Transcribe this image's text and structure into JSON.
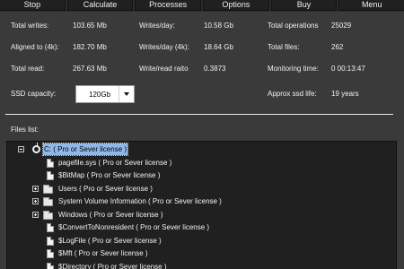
{
  "toolbar": {
    "stop": "Stop",
    "calculate": "Calculate",
    "processes": "Processes",
    "options": "Options",
    "buy": "Buy",
    "menu": "Menu"
  },
  "stats": {
    "total_writes_label": "Total writes:",
    "total_writes_value": "103.65 Mb",
    "aligned_label": "Aligned to (4k):",
    "aligned_value": "182.70 Mb",
    "total_read_label": "Total read:",
    "total_read_value": "267.63 Mb",
    "writes_day_label": "Writes/day:",
    "writes_day_value": "10.58 Gb",
    "writes_day_4k_label": "Writes/day (4k):",
    "writes_day_4k_value": "18.64 Gb",
    "write_read_ratio_label": "Write/read raito",
    "write_read_ratio_value": "0.3873",
    "total_operations_label": "Total operations",
    "total_operations_value": "25029",
    "total_files_label": "Total files:",
    "total_files_value": "262",
    "monitoring_time_label": "Monitoring time:",
    "monitoring_time_value": "0 00:13:47",
    "ssd_capacity_label": "SSD capacity:",
    "ssd_capacity_value": "120Gb",
    "approx_life_label": "Approx ssd life:",
    "approx_life_value": "19 years"
  },
  "files": {
    "list_label": "Files list:",
    "tree": [
      {
        "text": "C: ( Pro or Sever license )",
        "type": "drive",
        "expander": "minus",
        "selected": true,
        "name": "tree-node-drive-c"
      },
      {
        "text": "pagefile.sys ( Pro or Sever license )",
        "type": "file",
        "name": "tree-node-pagefile"
      },
      {
        "text": "$BitMap ( Pro or Sever license )",
        "type": "file",
        "name": "tree-node-bitmap"
      },
      {
        "text": "Users ( Pro or Sever license )",
        "type": "folder",
        "expander": "plus",
        "name": "tree-node-users"
      },
      {
        "text": "System Volume Information ( Pro or Sever license )",
        "type": "folder",
        "expander": "plus",
        "name": "tree-node-system-volume-information"
      },
      {
        "text": "Windows ( Pro or Sever license )",
        "type": "folder",
        "expander": "plus",
        "name": "tree-node-windows"
      },
      {
        "text": "$ConvertToNonresident ( Pro or Sever license )",
        "type": "file",
        "name": "tree-node-convert-to-nonresident"
      },
      {
        "text": "$LogFile ( Pro or Sever license )",
        "type": "file",
        "name": "tree-node-logfile"
      },
      {
        "text": "$Mft ( Pro or Sever license )",
        "type": "file",
        "name": "tree-node-mft"
      },
      {
        "text": "$Directory ( Pro or Sever license )",
        "type": "file",
        "name": "tree-node-directory"
      }
    ]
  }
}
